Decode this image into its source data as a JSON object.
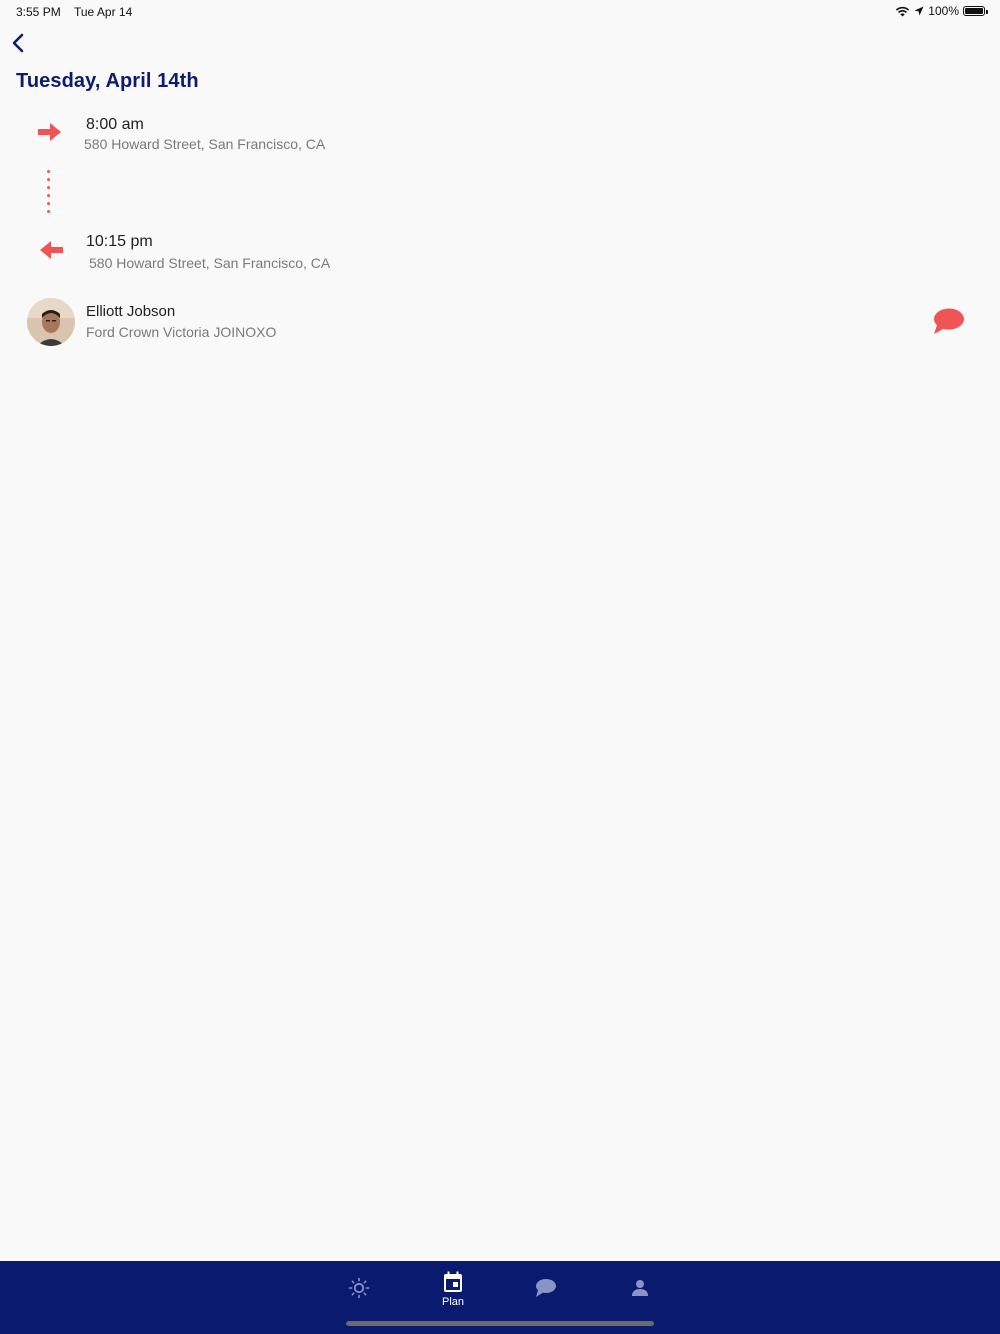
{
  "status_bar": {
    "time": "3:55 PM",
    "date": "Tue Apr 14",
    "battery_pct": "100%"
  },
  "header": {
    "title": "Tuesday, April 14th"
  },
  "trip": {
    "departure": {
      "time": "8:00 am",
      "address": "580 Howard Street, San Francisco, CA",
      "icon": "arrow-right-icon"
    },
    "return": {
      "time": "10:15 pm",
      "address": "580 Howard Street, San Francisco, CA",
      "icon": "arrow-left-icon"
    }
  },
  "driver": {
    "name": "Elliott Jobson",
    "car": "Ford Crown Victoria JOINOXO",
    "chat_icon": "chat-bubble-icon"
  },
  "tab_bar": {
    "tabs": [
      {
        "icon": "sun-icon",
        "label": ""
      },
      {
        "icon": "calendar-icon",
        "label": "Plan",
        "active": true
      },
      {
        "icon": "chat-icon",
        "label": ""
      },
      {
        "icon": "person-icon",
        "label": ""
      }
    ]
  },
  "colors": {
    "accent": "#f05454",
    "brand": "#0a1a6e",
    "title": "#0d1c6e",
    "background": "#f9f9f9"
  }
}
